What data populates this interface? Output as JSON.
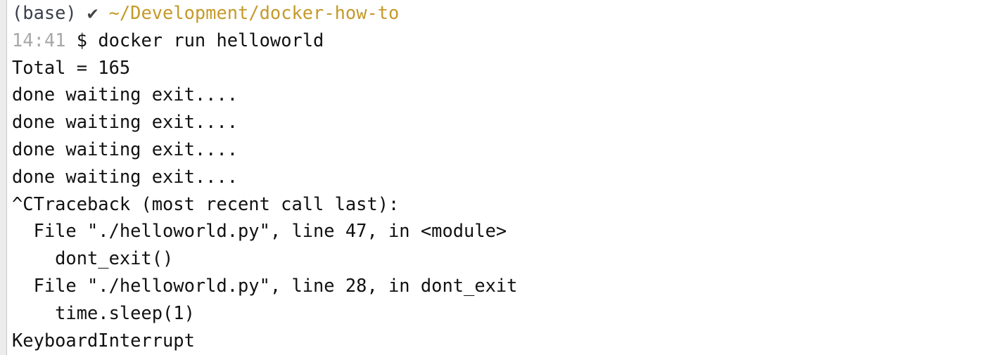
{
  "prompt": {
    "env": "(base)",
    "status_icon": "✔",
    "path": "~/Development/docker-how-to",
    "time": "14:41",
    "symbol": "$",
    "command": "docker run helloworld"
  },
  "colors": {
    "path": "#c49a2a",
    "time": "#a8a8a8",
    "text": "#111111"
  },
  "output": [
    "Total = 165",
    "done waiting exit....",
    "done waiting exit....",
    "done waiting exit....",
    "done waiting exit....",
    "^CTraceback (most recent call last):",
    "  File \"./helloworld.py\", line 47, in <module>",
    "    dont_exit()",
    "  File \"./helloworld.py\", line 28, in dont_exit",
    "    time.sleep(1)",
    "KeyboardInterrupt"
  ]
}
